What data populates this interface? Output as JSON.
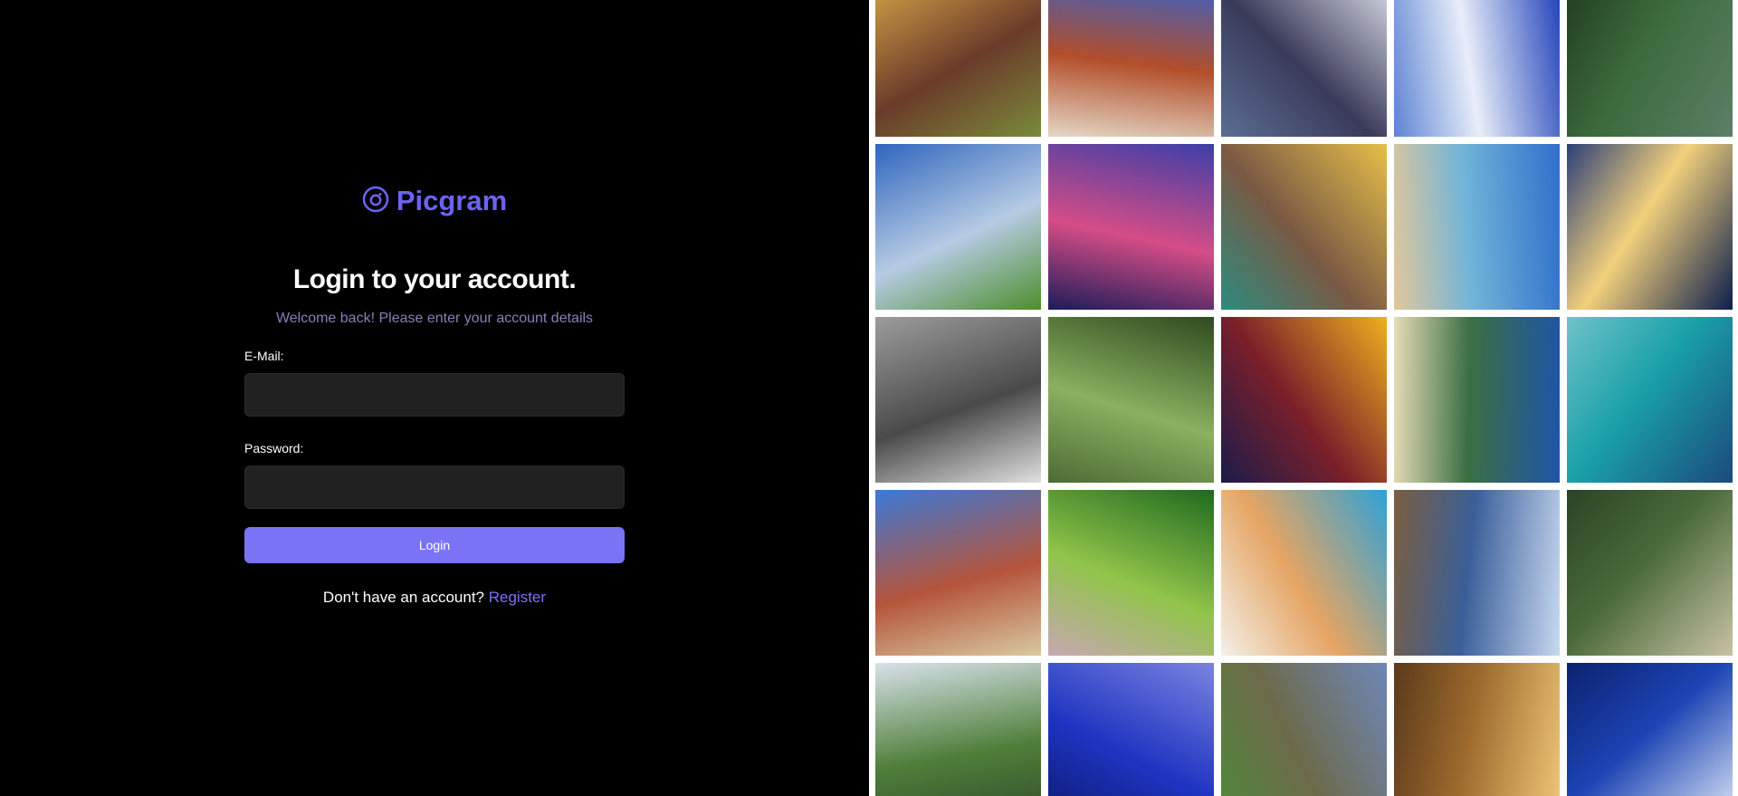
{
  "brand": {
    "name": "Picgram",
    "accent_color": "#6d63f2",
    "icon": "camera-circle-icon"
  },
  "login": {
    "heading": "Login to your account.",
    "subheading": "Welcome back! Please enter your account details",
    "email_label": "E-Mail:",
    "email_value": "",
    "password_label": "Password:",
    "password_value": "",
    "button_label": "Login",
    "button_color": "#7b73f5",
    "no_account_text": "Don't have an account?",
    "register_link": "Register"
  },
  "gallery": {
    "tiles": [
      {
        "name": "photo-spice-sacks",
        "colors": [
          "#d9a94a",
          "#6b3b2a",
          "#7a8a3a"
        ]
      },
      {
        "name": "photo-forbidden-city",
        "colors": [
          "#2a64d8",
          "#b24e2a",
          "#e4d8c6"
        ]
      },
      {
        "name": "photo-ocean-waves",
        "colors": [
          "#dfe3ea",
          "#3a3a5a",
          "#5a6e93"
        ]
      },
      {
        "name": "photo-snowy-mountain",
        "colors": [
          "#1e3fb8",
          "#e8eef9",
          "#5d83d3"
        ]
      },
      {
        "name": "photo-green-tea-hills",
        "colors": [
          "#5b7f68",
          "#3c6a3b",
          "#1f3a20"
        ]
      },
      {
        "name": "photo-grass-sky",
        "colors": [
          "#2f66be",
          "#b6cbe4",
          "#4c8e2c"
        ]
      },
      {
        "name": "photo-bokeh-lights",
        "colors": [
          "#3d3ea8",
          "#d54d86",
          "#1d1c5a"
        ]
      },
      {
        "name": "photo-sea-shells",
        "colors": [
          "#e6bf49",
          "#7a5944",
          "#2d8b7e"
        ]
      },
      {
        "name": "photo-palm-beach",
        "colors": [
          "#2f6fcb",
          "#6fb4d9",
          "#e2c79a"
        ]
      },
      {
        "name": "photo-bottle-sunset",
        "colors": [
          "#0c1e4d",
          "#f2d07c",
          "#2c3f77"
        ]
      },
      {
        "name": "photo-camel-face",
        "colors": [
          "#9c9c9c",
          "#4a4a4a",
          "#e0e0e0"
        ]
      },
      {
        "name": "photo-forest-path",
        "colors": [
          "#2f4a1f",
          "#8ab060",
          "#4d6b35"
        ]
      },
      {
        "name": "photo-taj-mahal",
        "colors": [
          "#efb01f",
          "#7b1f2a",
          "#1b1c4a"
        ]
      },
      {
        "name": "photo-tropical-island",
        "colors": [
          "#1f54a8",
          "#3a6f42",
          "#e8dcb9"
        ]
      },
      {
        "name": "photo-blue-bay",
        "colors": [
          "#1b4a7c",
          "#1aa0a8",
          "#6fc2c9"
        ]
      },
      {
        "name": "photo-cottages",
        "colors": [
          "#3c79d6",
          "#b4543a",
          "#d9c9a0"
        ]
      },
      {
        "name": "photo-green-leaves",
        "colors": [
          "#1f6a1f",
          "#91c44a",
          "#c7a7b0"
        ]
      },
      {
        "name": "photo-hanging-shells",
        "colors": [
          "#2ea2d8",
          "#e5a463",
          "#f4f0e8"
        ]
      },
      {
        "name": "photo-lake-pier",
        "colors": [
          "#c8d8f1",
          "#3a5f99",
          "#7b5e3f"
        ]
      },
      {
        "name": "photo-tea-plantation",
        "colors": [
          "#c8c2a3",
          "#4a6a3a",
          "#2a4424"
        ]
      },
      {
        "name": "photo-valley-fields",
        "colors": [
          "#d8e1ea",
          "#4f7f3a",
          "#2f4a2a"
        ]
      },
      {
        "name": "photo-blue-pier",
        "colors": [
          "#7a84e0",
          "#1e33c2",
          "#0c1a6b"
        ]
      },
      {
        "name": "photo-vineyard-lake",
        "colors": [
          "#6e87b8",
          "#6d6a4a",
          "#4f8a3a"
        ]
      },
      {
        "name": "photo-desert-rocks",
        "colors": [
          "#f0c97a",
          "#9d6a2c",
          "#5a3a1c"
        ]
      },
      {
        "name": "photo-blue-mountain-lake",
        "colors": [
          "#e7eef9",
          "#1b44b4",
          "#0d2270"
        ]
      }
    ]
  }
}
